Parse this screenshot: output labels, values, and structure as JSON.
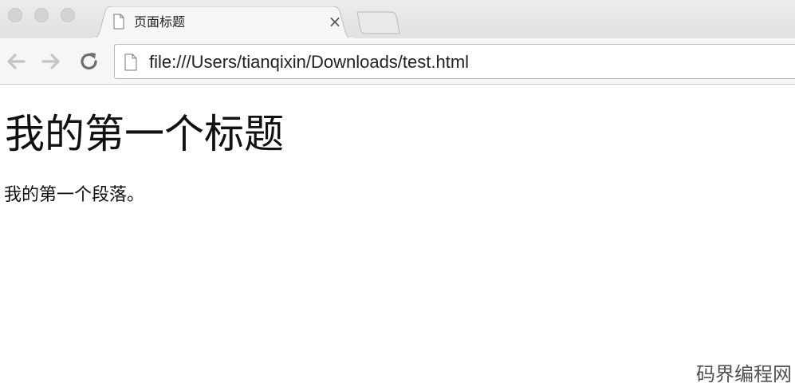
{
  "tab": {
    "title": "页面标题",
    "close_glyph": "×",
    "icon": "page-icon"
  },
  "toolbar": {
    "back_icon": "arrow-left-icon",
    "forward_icon": "arrow-right-icon",
    "reload_icon": "reload-icon",
    "omnibox_icon": "page-icon",
    "url": "file:///Users/tianqixin/Downloads/test.html"
  },
  "page": {
    "heading": "我的第一个标题",
    "paragraph": "我的第一个段落。"
  },
  "watermark": "码界编程网",
  "colors": {
    "tabstrip_bg": "#e4e4e4",
    "toolbar_bg": "#f6f6f6",
    "page_bg": "#ffffff",
    "text": "#111111"
  }
}
